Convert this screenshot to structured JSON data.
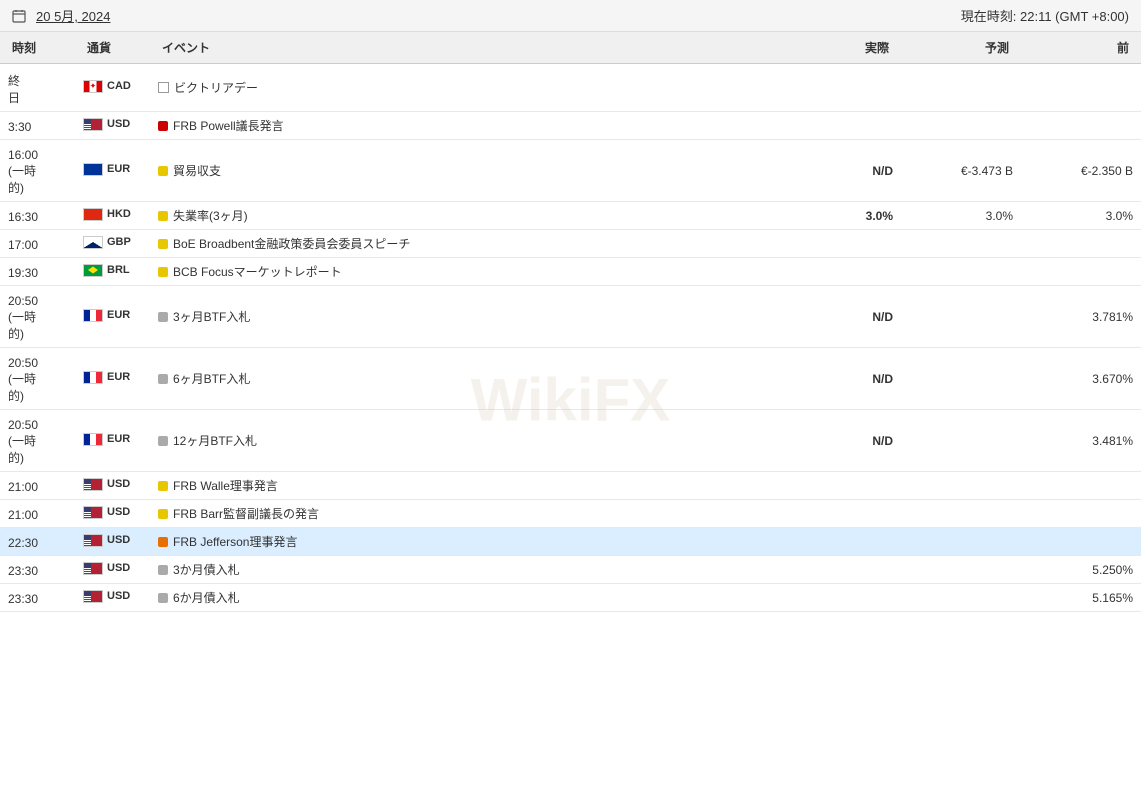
{
  "header": {
    "date": "20 5月, 2024",
    "current_time_label": "現在時刻:",
    "current_time": "22:11 (GMT +8:00)"
  },
  "columns": {
    "time": "時刻",
    "currency": "通貨",
    "event": "イベント",
    "actual": "実際",
    "forecast": "予測",
    "prev": "前"
  },
  "rows": [
    {
      "time": "終\n日",
      "currency": "CAD",
      "flag": "ca",
      "importance": "checkbox",
      "event": "ビクトリアデー",
      "actual": "",
      "forecast": "",
      "prev": "",
      "highlighted": false
    },
    {
      "time": "3:30",
      "currency": "USD",
      "flag": "us",
      "importance": "red",
      "event": "FRB Powell議長発言",
      "actual": "",
      "forecast": "",
      "prev": "",
      "highlighted": false
    },
    {
      "time": "16:00\n(一時\n的)",
      "currency": "EUR",
      "flag": "eu",
      "importance": "yellow",
      "event": "貿易収支",
      "actual": "N/D",
      "forecast": "€-3.473 B",
      "prev": "€-2.350 B",
      "highlighted": false
    },
    {
      "time": "16:30",
      "currency": "HKD",
      "flag": "hk",
      "importance": "yellow",
      "event": "失業率(3ヶ月)",
      "actual": "3.0%",
      "forecast": "3.0%",
      "prev": "3.0%",
      "highlighted": false
    },
    {
      "time": "17:00",
      "currency": "GBP",
      "flag": "gb",
      "importance": "yellow",
      "event": "BoE Broadbent金融政策委員会委員スピーチ",
      "actual": "",
      "forecast": "",
      "prev": "",
      "highlighted": false
    },
    {
      "time": "19:30",
      "currency": "BRL",
      "flag": "br",
      "importance": "yellow",
      "event": "BCB Focusマーケットレポート",
      "actual": "",
      "forecast": "",
      "prev": "",
      "highlighted": false
    },
    {
      "time": "20:50\n(一時\n的)",
      "currency": "EUR",
      "flag": "fr",
      "importance": "gray",
      "event": "3ヶ月BTF入札",
      "actual": "N/D",
      "forecast": "",
      "prev": "3.781%",
      "highlighted": false
    },
    {
      "time": "20:50\n(一時\n的)",
      "currency": "EUR",
      "flag": "fr",
      "importance": "gray",
      "event": "6ヶ月BTF入札",
      "actual": "N/D",
      "forecast": "",
      "prev": "3.670%",
      "highlighted": false
    },
    {
      "time": "20:50\n(一時\n的)",
      "currency": "EUR",
      "flag": "fr",
      "importance": "gray",
      "event": "12ヶ月BTF入札",
      "actual": "N/D",
      "forecast": "",
      "prev": "3.481%",
      "highlighted": false
    },
    {
      "time": "21:00",
      "currency": "USD",
      "flag": "us",
      "importance": "yellow",
      "event": "FRB Walle理事発言",
      "actual": "",
      "forecast": "",
      "prev": "",
      "highlighted": false
    },
    {
      "time": "21:00",
      "currency": "USD",
      "flag": "us",
      "importance": "yellow",
      "event": "FRB Barr監督副議長の発言",
      "actual": "",
      "forecast": "",
      "prev": "",
      "highlighted": false
    },
    {
      "time": "22:30",
      "currency": "USD",
      "flag": "us",
      "importance": "orange",
      "event": "FRB Jefferson理事発言",
      "actual": "",
      "forecast": "",
      "prev": "",
      "highlighted": true
    },
    {
      "time": "23:30",
      "currency": "USD",
      "flag": "us",
      "importance": "gray",
      "event": "3か月債入札",
      "actual": "",
      "forecast": "",
      "prev": "5.250%",
      "highlighted": false
    },
    {
      "time": "23:30",
      "currency": "USD",
      "flag": "us",
      "importance": "gray",
      "event": "6か月債入札",
      "actual": "",
      "forecast": "",
      "prev": "5.165%",
      "highlighted": false
    }
  ],
  "watermark": "WikiFX"
}
